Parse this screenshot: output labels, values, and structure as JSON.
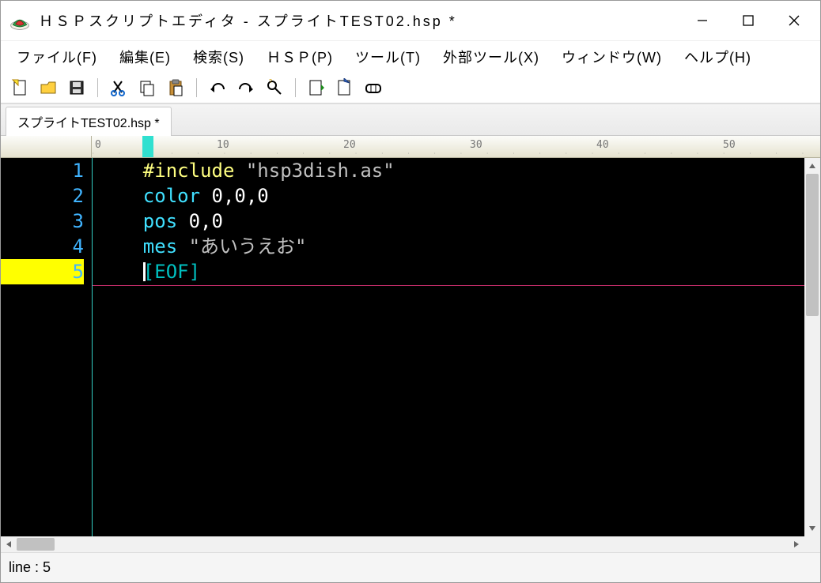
{
  "window": {
    "title": "ＨＳＰスクリプトエディタ - スプライトTEST02.hsp *"
  },
  "menubar": {
    "items": [
      "ファイル(F)",
      "編集(E)",
      "検索(S)",
      "ＨＳＰ(P)",
      "ツール(T)",
      "外部ツール(X)",
      "ウィンドウ(W)",
      "ヘルプ(H)"
    ]
  },
  "tabs": {
    "items": [
      {
        "label": "スプライトTEST02.hsp *"
      }
    ]
  },
  "ruler": {
    "marks": [
      "0",
      "10",
      "20",
      "30",
      "40",
      "50"
    ]
  },
  "editor": {
    "lines": [
      {
        "n": "1",
        "tokens": [
          {
            "cls": "tok-preproc",
            "t": "#include"
          },
          {
            "cls": "tok-num",
            "t": " "
          },
          {
            "cls": "tok-string",
            "t": "\"hsp3dish.as\""
          }
        ]
      },
      {
        "n": "2",
        "tokens": [
          {
            "cls": "tok-cmd",
            "t": "color"
          },
          {
            "cls": "tok-num",
            "t": " 0,0,0"
          }
        ]
      },
      {
        "n": "3",
        "tokens": [
          {
            "cls": "tok-cmd",
            "t": "pos"
          },
          {
            "cls": "tok-num",
            "t": " 0,0"
          }
        ]
      },
      {
        "n": "4",
        "tokens": [
          {
            "cls": "tok-cmd",
            "t": "mes"
          },
          {
            "cls": "tok-num",
            "t": " "
          },
          {
            "cls": "tok-string",
            "t": "\"あいうえお\""
          }
        ]
      },
      {
        "n": "5",
        "current": true,
        "tokens": [
          {
            "cls": "tok-eof",
            "t": "[EOF]"
          }
        ]
      }
    ]
  },
  "statusbar": {
    "text": "line : 5"
  }
}
